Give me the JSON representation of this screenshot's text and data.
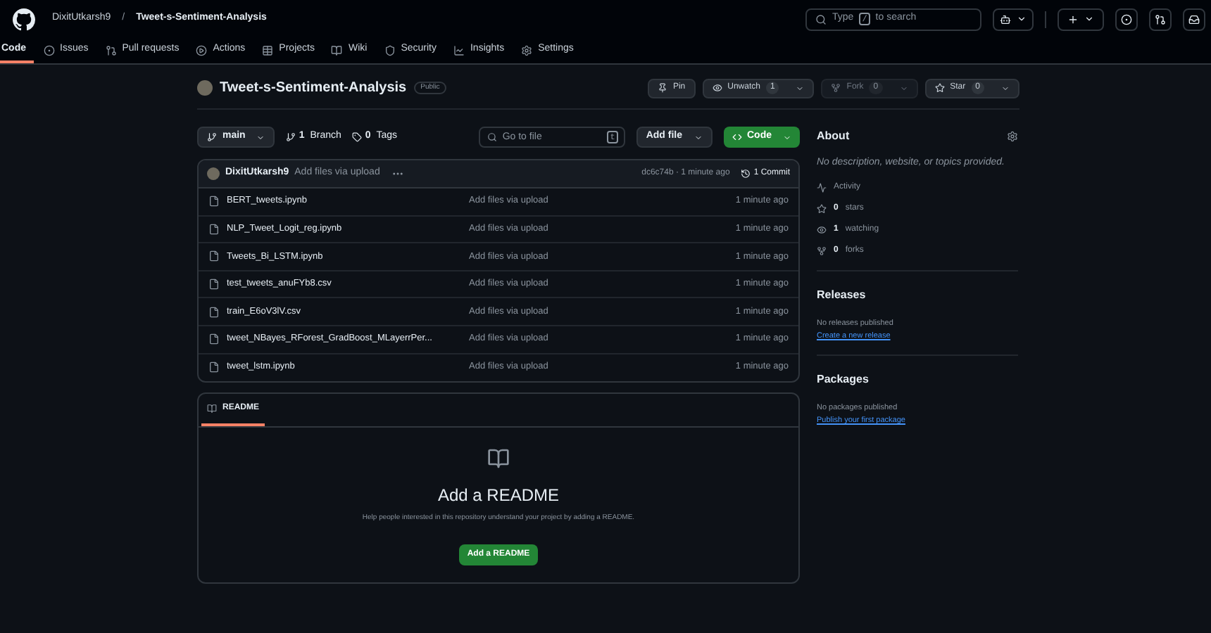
{
  "header": {
    "owner": "DixitUtkarsh9",
    "separator": "/",
    "repo": "Tweet-s-Sentiment-Analysis",
    "search": {
      "before": "Type",
      "key": "/",
      "after": "to search"
    }
  },
  "nav_tabs": [
    {
      "label": "Code",
      "kind": "code",
      "selected": true
    },
    {
      "label": "Issues",
      "kind": "issues",
      "selected": false
    },
    {
      "label": "Pull requests",
      "kind": "pulls",
      "selected": false
    },
    {
      "label": "Actions",
      "kind": "actions",
      "selected": false
    },
    {
      "label": "Projects",
      "kind": "projects",
      "selected": false
    },
    {
      "label": "Wiki",
      "kind": "wiki",
      "selected": false
    },
    {
      "label": "Security",
      "kind": "security",
      "selected": false
    },
    {
      "label": "Insights",
      "kind": "insights",
      "selected": false
    },
    {
      "label": "Settings",
      "kind": "settings",
      "selected": false
    }
  ],
  "repo": {
    "name": "Tweet-s-Sentiment-Analysis",
    "visibility": "Public"
  },
  "repo_actions": [
    {
      "kind": "pin",
      "label": "Pin",
      "disabled": false
    },
    {
      "kind": "watch",
      "label": "Unwatch",
      "count": "1",
      "disabled": false
    },
    {
      "kind": "fork",
      "label": "Fork",
      "count": "0",
      "disabled": true
    },
    {
      "kind": "star",
      "label": "Star",
      "count": "0",
      "disabled": false
    }
  ],
  "toolbar": {
    "branch": "main",
    "branches": {
      "count": "1",
      "label": "Branch"
    },
    "tags": {
      "count": "0",
      "label": "Tags"
    },
    "go_to_file": {
      "placeholder": "Go to file",
      "key": "t"
    },
    "add_file": "Add file",
    "code": "Code"
  },
  "latest_commit": {
    "author": "DixitUtkarsh9",
    "message": "Add files via upload",
    "hash_time": "dc6c74b · 1 minute ago",
    "commits": "1 Commit"
  },
  "files": [
    {
      "name": "BERT_tweets.ipynb",
      "message": "Add files via upload",
      "time": "1 minute ago"
    },
    {
      "name": "NLP_Tweet_Logit_reg.ipynb",
      "message": "Add files via upload",
      "time": "1 minute ago"
    },
    {
      "name": "Tweets_Bi_LSTM.ipynb",
      "message": "Add files via upload",
      "time": "1 minute ago"
    },
    {
      "name": "test_tweets_anuFYb8.csv",
      "message": "Add files via upload",
      "time": "1 minute ago"
    },
    {
      "name": "train_E6oV3lV.csv",
      "message": "Add files via upload",
      "time": "1 minute ago"
    },
    {
      "name": "tweet_NBayes_RForest_GradBoost_MLayerrPer...",
      "message": "Add files via upload",
      "time": "1 minute ago"
    },
    {
      "name": "tweet_lstm.ipynb",
      "message": "Add files via upload",
      "time": "1 minute ago"
    }
  ],
  "readme": {
    "tab": "README",
    "title": "Add a README",
    "description": "Help people interested in this repository understand your project by adding a README.",
    "button": "Add a README"
  },
  "about": {
    "heading": "About",
    "description": "No description, website, or topics provided.",
    "stats": [
      {
        "kind": "activity",
        "label": "Activity"
      },
      {
        "kind": "stars",
        "count": "0",
        "label": "stars"
      },
      {
        "kind": "watching",
        "count": "1",
        "label": "watching"
      },
      {
        "kind": "forks",
        "count": "0",
        "label": "forks"
      }
    ]
  },
  "releases": {
    "heading": "Releases",
    "note": "No releases published",
    "link": "Create a new release"
  },
  "packages": {
    "heading": "Packages",
    "note": "No packages published",
    "link": "Publish your first package"
  }
}
